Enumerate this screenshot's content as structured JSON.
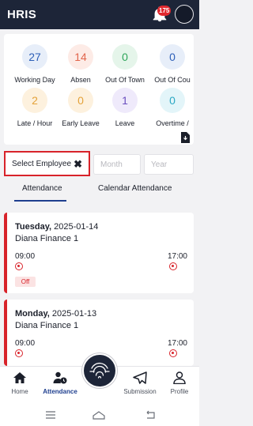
{
  "app": {
    "title": "HRIS",
    "notification_count": "175"
  },
  "summary": {
    "stats": [
      {
        "value": "27",
        "label": "Working Day",
        "color": "#2d5fb8",
        "bg": "#e7eef9"
      },
      {
        "value": "14",
        "label": "Absen",
        "color": "#e2654c",
        "bg": "#fdebe6"
      },
      {
        "value": "0",
        "label": "Out Of Town",
        "color": "#2fa55a",
        "bg": "#e5f5ea"
      },
      {
        "value": "0",
        "label": "Out Of Cou",
        "color": "#2d5fb8",
        "bg": "#e7eef9"
      },
      {
        "value": "2",
        "label": "Late / Hour",
        "color": "#e4a23a",
        "bg": "#fdf1de"
      },
      {
        "value": "0",
        "label": "Early Leave",
        "color": "#e4a23a",
        "bg": "#fdf1de"
      },
      {
        "value": "1",
        "label": "Leave",
        "color": "#6a4fbf",
        "bg": "#efeafb"
      },
      {
        "value": "0",
        "label": "Overtime /",
        "color": "#2ba8c4",
        "bg": "#e3f5f9"
      }
    ]
  },
  "filters": {
    "employee": "Select Employee",
    "month": "Month",
    "year": "Year"
  },
  "tabs": {
    "attendance": "Attendance",
    "calendar": "Calendar Attendance"
  },
  "records": [
    {
      "weekday": "Tuesday,",
      "date": "2025-01-14",
      "name": "Diana Finance 1",
      "time_in": "09:00",
      "time_out": "17:00",
      "status": "Off"
    },
    {
      "weekday": "Monday,",
      "date": "2025-01-13",
      "name": "Diana Finance 1",
      "time_in": "09:00",
      "time_out": "17:00"
    }
  ],
  "nav": {
    "home": "Home",
    "attendance": "Attendance",
    "submission": "Submission",
    "profile": "Profile"
  },
  "colors": {
    "header": "#1d2538",
    "accent": "#d8232a",
    "active": "#1f3f8f"
  }
}
